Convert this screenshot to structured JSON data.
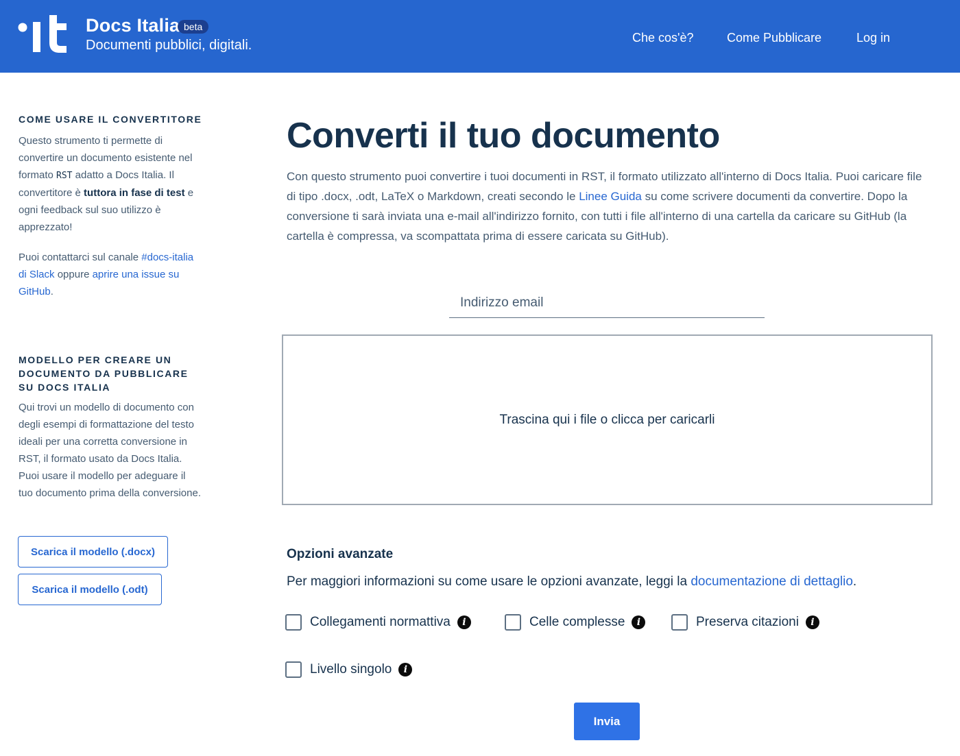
{
  "header": {
    "brand_title": "Docs Italia",
    "beta_badge": "beta",
    "brand_subtitle": "Documenti pubblici, digitali.",
    "nav": [
      {
        "label": "Che cos'è?"
      },
      {
        "label": "Come Pubblicare"
      },
      {
        "label": "Log in"
      }
    ]
  },
  "sidebar": {
    "section1": {
      "title": "Come usare il convertitore",
      "p1_a": "Questo strumento ti permette di convertire un documento esistente nel formato ",
      "p1_rst": "RST",
      "p1_b": " adatto a Docs Italia. Il convertitore è ",
      "p1_bold": "tuttora in fase di test",
      "p1_c": " e ogni feedback sul suo utilizzo è apprezzato!",
      "p2_a": "Puoi contattarci sul canale ",
      "p2_link1": "#docs-italia di Slack",
      "p2_b": " oppure ",
      "p2_link2": "aprire una issue su GitHub",
      "p2_c": "."
    },
    "section2": {
      "title": "Modello per creare un documento da pubblicare su Docs Italia",
      "text": "Qui trovi un modello di documento con degli esempi di formattazione del testo ideali per una corretta conversione in RST, il formato usato da Docs Italia. Puoi usare il modello per adeguare il tuo documento prima della conversione.",
      "btn_docx": "Scarica il modello (.docx)",
      "btn_odt": "Scarica il modello (.odt)"
    }
  },
  "main": {
    "title": "Converti il tuo documento",
    "intro_a": "Con questo strumento puoi convertire i tuoi documenti in RST, il formato utilizzato all'interno di Docs Italia. Puoi caricare file di tipo .docx, .odt, LaTeX o Markdown, creati secondo le ",
    "intro_link": "Linee Guida",
    "intro_b": " su come scrivere documenti da convertire. Dopo la conversione ti sarà inviata una e-mail all'indirizzo fornito, con tutti i file all'interno di una cartella da caricare su GitHub (la cartella è compressa, va scompattata prima di essere caricata su GitHub).",
    "email_placeholder": "Indirizzo email",
    "email_value": "",
    "dropzone_text": "Trascina qui i file o clicca per caricarli",
    "advanced": {
      "title": "Opzioni avanzate",
      "desc_a": "Per maggiori informazioni su come usare le opzioni avanzate, leggi la ",
      "desc_link": "documentazione di dettaglio",
      "desc_b": ".",
      "options": [
        {
          "label": "Collegamenti normattiva",
          "checked": false
        },
        {
          "label": "Celle complesse",
          "checked": false
        },
        {
          "label": "Preserva citazioni",
          "checked": false
        },
        {
          "label": "Livello singolo",
          "checked": false
        }
      ]
    },
    "submit_label": "Invia"
  }
}
